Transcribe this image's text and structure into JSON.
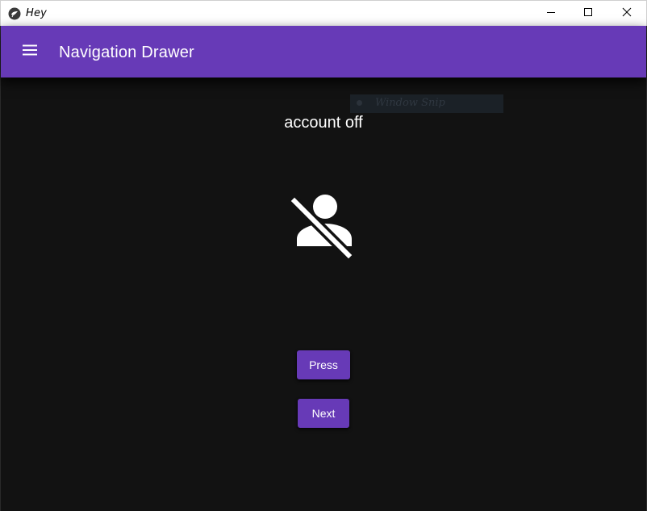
{
  "window": {
    "title": "Hey",
    "app_icon": "kivy-logo-icon",
    "controls": [
      "minimize-icon",
      "maximize-icon",
      "close-icon"
    ]
  },
  "appbar": {
    "title": "Navigation Drawer",
    "menu_icon": "menu-icon",
    "color": "#673ab7"
  },
  "main": {
    "label": "account off",
    "icon": "account-off-icon",
    "buttons": {
      "press_label": "Press",
      "next_label": "Next"
    },
    "background": "#121212"
  },
  "overlay": {
    "text": "Window Snip"
  }
}
